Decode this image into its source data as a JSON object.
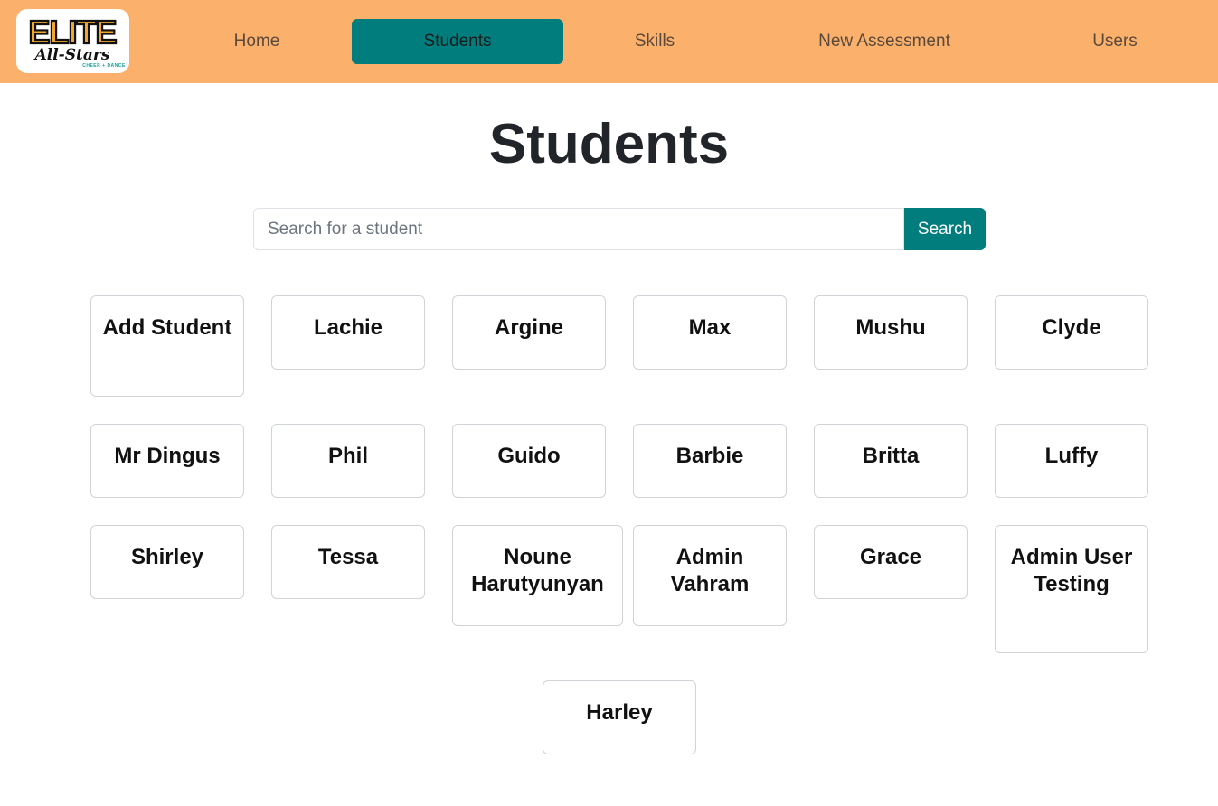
{
  "nav": {
    "logo": {
      "title": "ELITE",
      "subtitle": "All-Stars",
      "tagline": "CHEER + DANCE",
      "colors": {
        "gold": "#f3a72b",
        "outline": "#111111",
        "teal": "#1a9d9a"
      }
    },
    "items": [
      {
        "label": "Home"
      },
      {
        "label": "Students",
        "active": true
      },
      {
        "label": "Skills"
      },
      {
        "label": "New Assessment"
      },
      {
        "label": "Users"
      }
    ]
  },
  "page": {
    "title": "Students"
  },
  "search": {
    "placeholder": "Search for a student",
    "value": "",
    "button_label": "Search"
  },
  "students": [
    {
      "name": "Add Student"
    },
    {
      "name": "Lachie"
    },
    {
      "name": "Argine"
    },
    {
      "name": "Max"
    },
    {
      "name": "Mushu"
    },
    {
      "name": "Clyde"
    },
    {
      "name": "Mr Dingus"
    },
    {
      "name": "Phil"
    },
    {
      "name": "Guido"
    },
    {
      "name": "Barbie"
    },
    {
      "name": "Britta"
    },
    {
      "name": "Luffy"
    },
    {
      "name": "Shirley"
    },
    {
      "name": "Tessa"
    },
    {
      "name": "Noune Harutyunyan"
    },
    {
      "name": "Admin Vahram"
    },
    {
      "name": "Grace"
    },
    {
      "name": "Admin User Testing"
    },
    {
      "name": "Harley"
    }
  ],
  "colors": {
    "navbar": "#fbb06b",
    "accent": "#007d7c"
  }
}
